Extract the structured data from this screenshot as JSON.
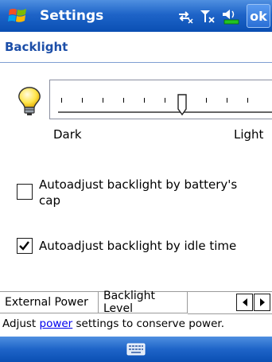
{
  "titlebar": {
    "title": "Settings",
    "ok_label": "ok"
  },
  "icons": {
    "start": "windows-flag-icon",
    "connectivity": "connectivity-arrows-icon",
    "signal": "signal-off-icon",
    "volume": "speaker-icon",
    "battery": "battery-icon",
    "bulb": "light-bulb-icon",
    "keyboard": "keyboard-icon"
  },
  "page": {
    "header": "Backlight"
  },
  "slider": {
    "min_label": "Dark",
    "max_label": "Light",
    "level": 0.63
  },
  "options": [
    {
      "label": "Autoadjust backlight by battery's cap",
      "checked": false
    },
    {
      "label": "Autoadjust backlight by idle time",
      "checked": true
    }
  ],
  "tabs": [
    {
      "label": "External Power",
      "active": false
    },
    {
      "label": "Backlight Level",
      "active": true
    }
  ],
  "footer": {
    "prefix": "Adjust ",
    "link": "power",
    "suffix": " settings to conserve power."
  },
  "colors": {
    "titlebar": "#1e64c8",
    "header_text": "#1c4ea8",
    "link": "#0000ee"
  }
}
